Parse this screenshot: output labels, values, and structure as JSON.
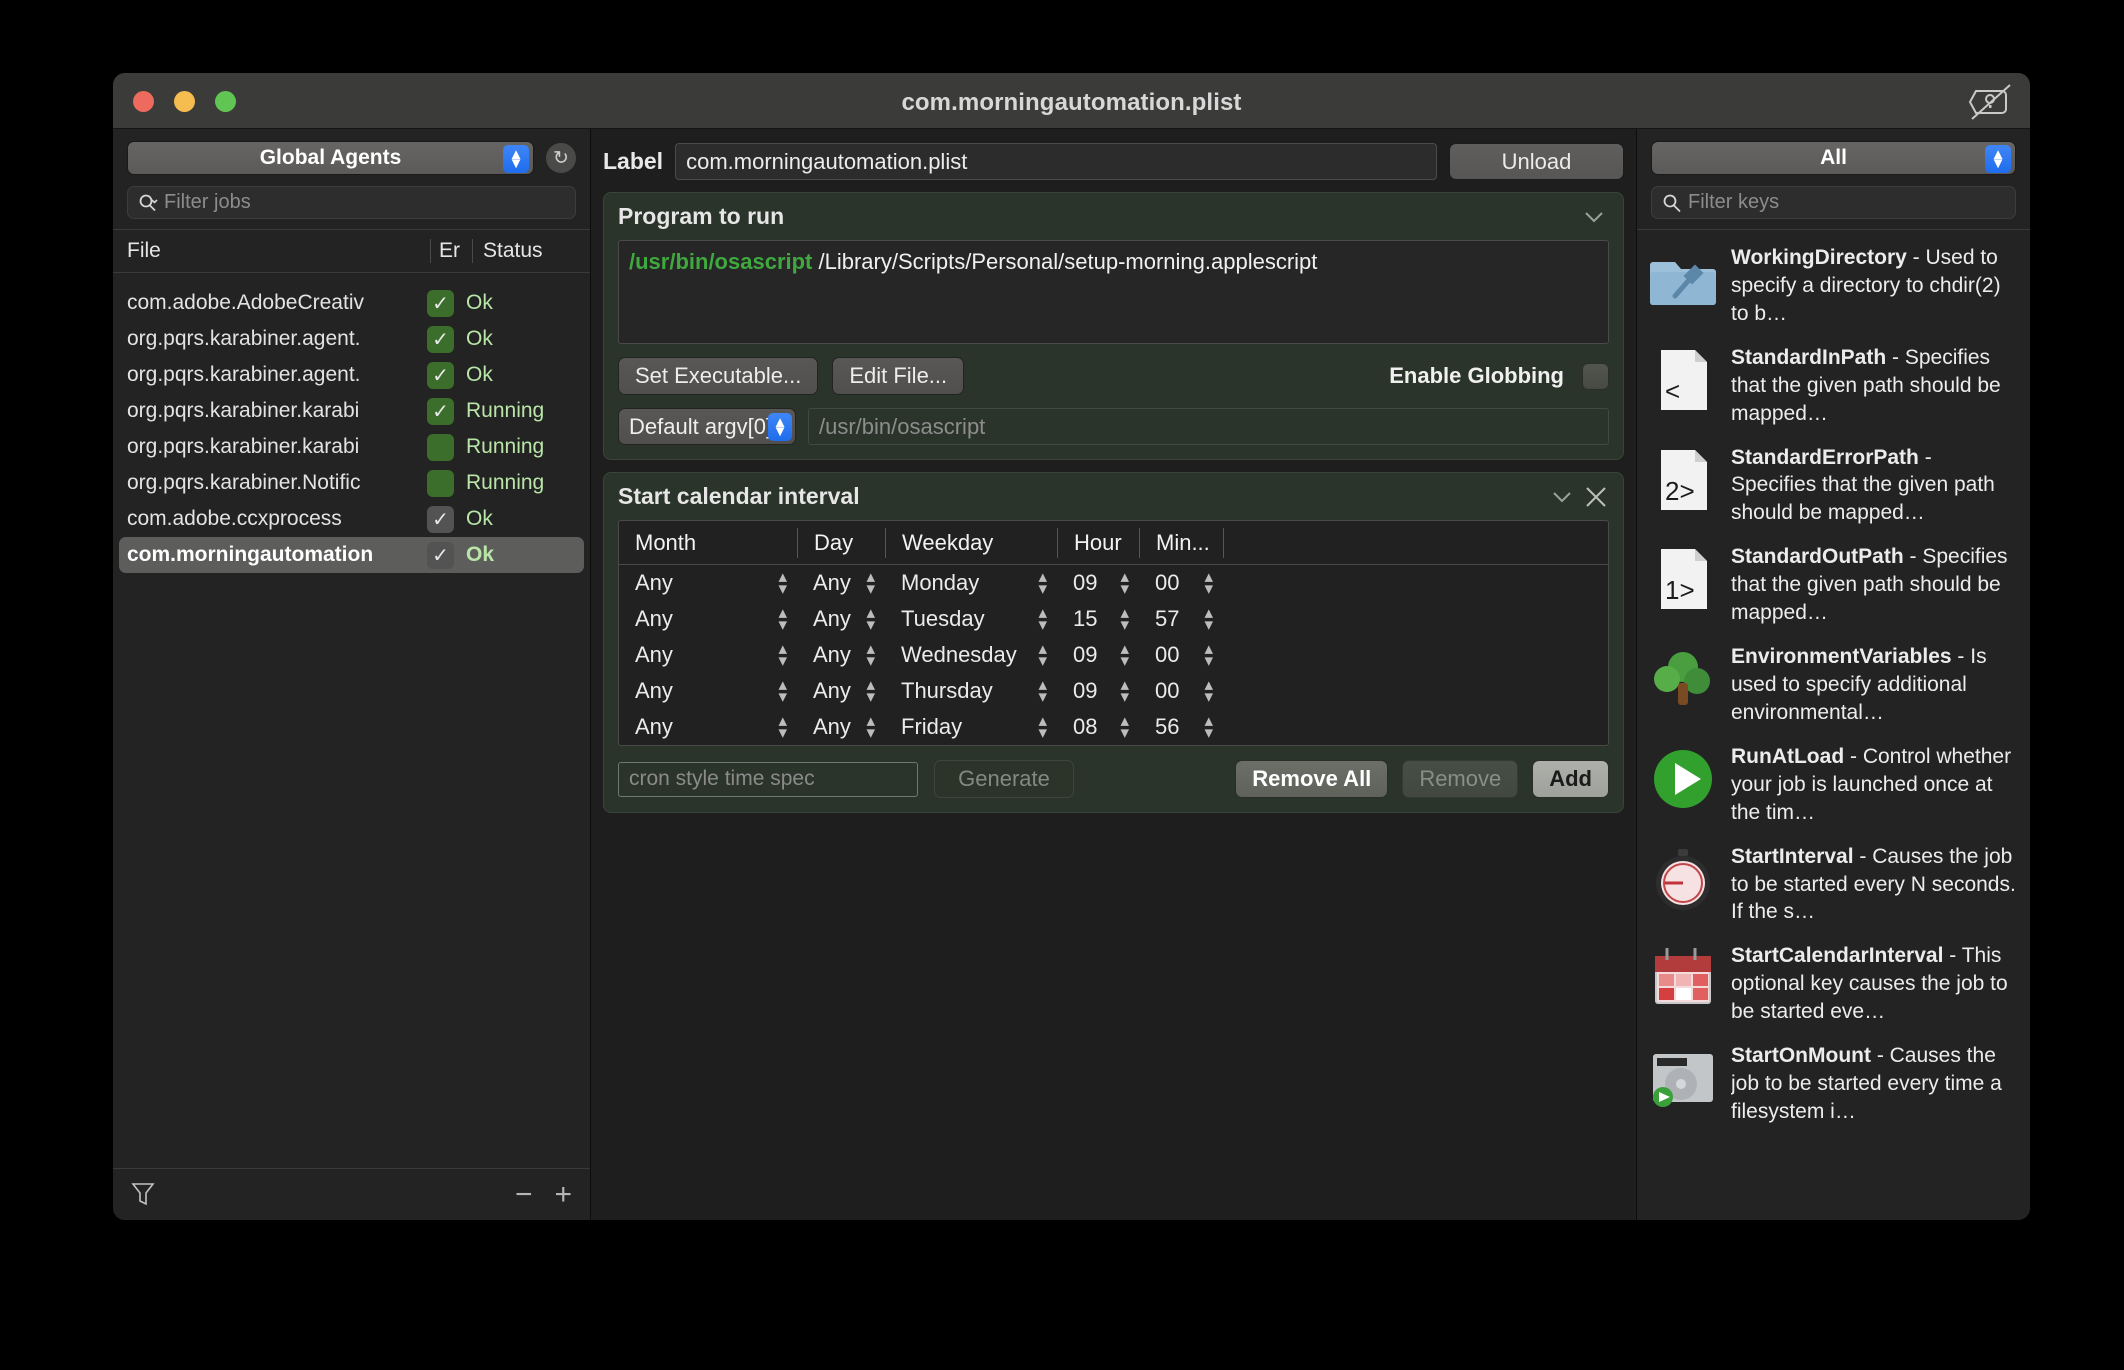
{
  "window": {
    "title": "com.morningautomation.plist",
    "tag_icon": "tag-slash-icon"
  },
  "sidebar": {
    "domain_popup": {
      "value": "Global Agents"
    },
    "refresh_icon": "refresh-icon",
    "filter": {
      "placeholder": "Filter jobs"
    },
    "columns": {
      "file": "File",
      "error": "Er",
      "status": "Status"
    },
    "rows": [
      {
        "file": "com.adobe.AdobeCreativ",
        "checked": true,
        "check_style": "green",
        "status": "Ok",
        "selected": false
      },
      {
        "file": "org.pqrs.karabiner.agent.",
        "checked": true,
        "check_style": "green",
        "status": "Ok",
        "selected": false
      },
      {
        "file": "org.pqrs.karabiner.agent.",
        "checked": true,
        "check_style": "green",
        "status": "Ok",
        "selected": false
      },
      {
        "file": "org.pqrs.karabiner.karabi",
        "checked": true,
        "check_style": "green",
        "status": "Running",
        "selected": false
      },
      {
        "file": "org.pqrs.karabiner.karabi",
        "checked": false,
        "check_style": "green",
        "status": "Running",
        "selected": false
      },
      {
        "file": "org.pqrs.karabiner.Notific",
        "checked": false,
        "check_style": "green",
        "status": "Running",
        "selected": false
      },
      {
        "file": "com.adobe.ccxprocess",
        "checked": true,
        "check_style": "grey",
        "status": "Ok",
        "selected": false
      },
      {
        "file": "com.morningautomation",
        "checked": true,
        "check_style": "grey",
        "status": "Ok",
        "selected": true
      }
    ],
    "footer": {
      "filter_icon": "funnel-icon",
      "remove_icon": "minus-icon",
      "add_icon": "plus-icon"
    }
  },
  "main": {
    "label_caption": "Label",
    "label_value": "com.morningautomation.plist",
    "unload_button": "Unload",
    "program_section": {
      "title": "Program to run",
      "collapse_icon": "chevron-down-icon",
      "executable": "/usr/bin/osascript",
      "arguments": " /Library/Scripts/Personal/setup-morning.applescript",
      "set_executable_button": "Set Executable...",
      "edit_file_button": "Edit File...",
      "enable_globbing_label": "Enable Globbing",
      "enable_globbing_checked": false,
      "argv_popup": "Default argv[0]",
      "argv_placeholder": "/usr/bin/osascript"
    },
    "calendar_section": {
      "title": "Start calendar interval",
      "collapse_icon": "chevron-down-icon",
      "close_icon": "close-icon",
      "columns": [
        "Month",
        "Day",
        "Weekday",
        "Hour",
        "Min..."
      ],
      "rows": [
        {
          "month": "Any",
          "day": "Any",
          "weekday": "Monday",
          "hour": "09",
          "minute": "00"
        },
        {
          "month": "Any",
          "day": "Any",
          "weekday": "Tuesday",
          "hour": "15",
          "minute": "57"
        },
        {
          "month": "Any",
          "day": "Any",
          "weekday": "Wednesday",
          "hour": "09",
          "minute": "00"
        },
        {
          "month": "Any",
          "day": "Any",
          "weekday": "Thursday",
          "hour": "09",
          "minute": "00"
        },
        {
          "month": "Any",
          "day": "Any",
          "weekday": "Friday",
          "hour": "08",
          "minute": "56"
        }
      ],
      "cron_placeholder": "cron style time spec",
      "generate_button": "Generate",
      "remove_all_button": "Remove All",
      "remove_button": "Remove",
      "add_button": "Add"
    }
  },
  "right_panel": {
    "scope_popup": {
      "value": "All"
    },
    "filter": {
      "placeholder": "Filter keys"
    },
    "keys": [
      {
        "name": "WorkingDirectory",
        "desc": "Used to specify a directory to chdir(2) to b…",
        "icon": "folder-tools-icon"
      },
      {
        "name": "StandardInPath",
        "desc": "Specifies that the given path should be mapped…",
        "icon": "file-stdin-icon"
      },
      {
        "name": "StandardErrorPath",
        "desc": "Specifies that the given path should be mapped…",
        "icon": "file-stderr-icon"
      },
      {
        "name": "StandardOutPath",
        "desc": "Specifies that the given path should be mapped…",
        "icon": "file-stdout-icon"
      },
      {
        "name": "EnvironmentVariables",
        "desc": "Is used to specify additional environmental…",
        "icon": "tree-icon"
      },
      {
        "name": "RunAtLoad",
        "desc": "Control whether your job is launched once at the tim…",
        "icon": "play-circle-icon"
      },
      {
        "name": "StartInterval",
        "desc": "Causes the job to be started every N seconds. If the s…",
        "icon": "stopwatch-icon"
      },
      {
        "name": "StartCalendarInterval",
        "desc": "This optional key causes the job to be started eve…",
        "icon": "calendar-icon"
      },
      {
        "name": "StartOnMount",
        "desc": "Causes the job to be started every time a filesystem i…",
        "icon": "harddisk-icon"
      }
    ]
  },
  "colors": {
    "accent_blue": "#2f7bf0",
    "section_green": "#2b342a",
    "exe_green": "#3fa83f",
    "status_green": "#b9e6a8",
    "checkbox_green": "#3c6e2b"
  }
}
